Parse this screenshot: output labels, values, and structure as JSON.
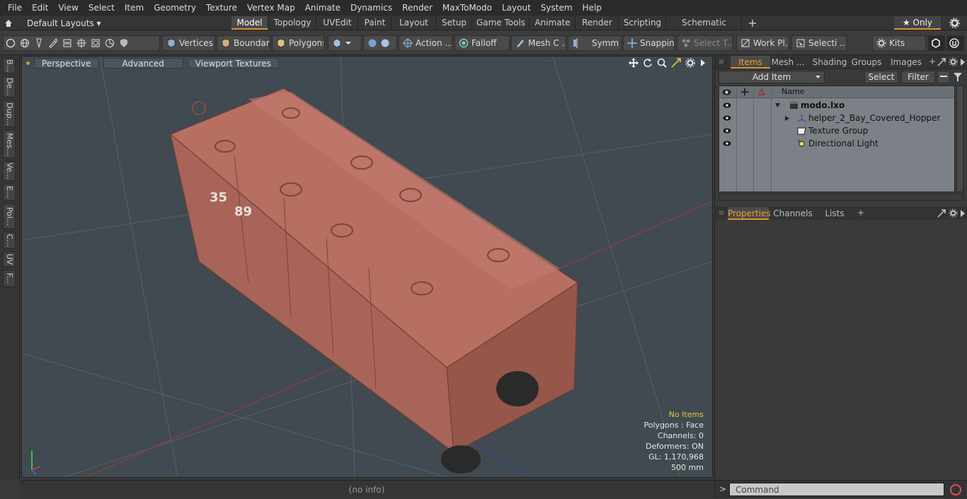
{
  "menu": [
    "File",
    "Edit",
    "View",
    "Select",
    "Item",
    "Geometry",
    "Texture",
    "Vertex Map",
    "Animate",
    "Dynamics",
    "Render",
    "MaxToModo",
    "Layout",
    "System",
    "Help"
  ],
  "layout_selector": "Default Layouts ▾",
  "mode_tabs": [
    "Model",
    "Topology",
    "UVEdit",
    "Paint",
    "Layout",
    "Setup",
    "Game Tools",
    "Animate",
    "Render",
    "Scripting",
    "Schematic Fusion"
  ],
  "active_mode_tab": "Model",
  "add_tab": "+",
  "only_button": "★ Only",
  "toolbar": {
    "vertices": "Vertices",
    "boundary": "Boundary",
    "polygons": "Polygons",
    "action": "Action ...",
    "falloff": "Falloff",
    "mesh": "Mesh C ...",
    "symm": "Symm ...",
    "snapping": "Snapping",
    "select_t": "Select T...",
    "work_pl": "Work Pl...",
    "selecti": "Selecti ...",
    "kits": "Kits"
  },
  "left_tabs": [
    "B...",
    "De...",
    "Dup...",
    "Mes...",
    "Ve...",
    "E...",
    "Pol...",
    "C...",
    "UV",
    "F..."
  ],
  "viewport": {
    "perspective": "Perspective",
    "advanced": "Advanced",
    "viewport_textures": "Viewport Textures",
    "hud": {
      "no_items": "No Items",
      "polygons": "Polygons : Face",
      "channels": "Channels: 0",
      "deformers": "Deformers: ON",
      "gl": "GL: 1,170,968",
      "scale": "500 mm"
    },
    "car_number_a": "35",
    "car_number_b": "89"
  },
  "status": "(no info)",
  "right": {
    "top_tabs": [
      "Items",
      "Mesh ...",
      "Shading",
      "Groups",
      "Images"
    ],
    "active_top_tab": "Items",
    "add_item": "Add Item",
    "select": "Select",
    "filter": "Filter",
    "name_header": "Name",
    "items": [
      {
        "name": "modo.lxo",
        "bold": true
      },
      {
        "name": "helper_2_Bay_Covered_Hopper",
        "bold": false
      },
      {
        "name": "Texture Group",
        "bold": false
      },
      {
        "name": "Directional Light",
        "bold": false
      }
    ],
    "bottom_tabs": [
      "Properties",
      "Channels",
      "Lists"
    ],
    "active_bottom_tab": "Properties",
    "command_placeholder": "Command",
    "prompt": ">"
  },
  "colors": {
    "accent": "#e0922e",
    "viewport_bg": "#404a50",
    "model": "#b76f62"
  }
}
